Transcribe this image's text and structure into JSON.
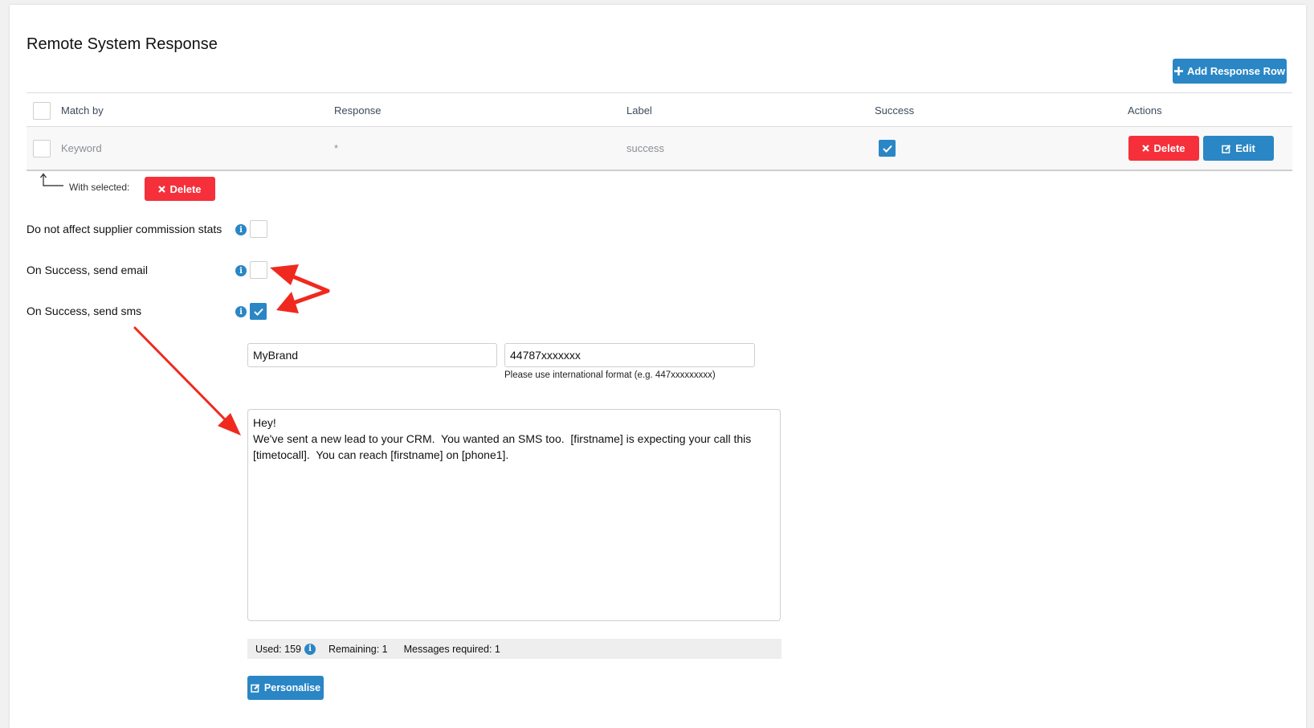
{
  "title": "Remote System Response",
  "add_button": "Add Response Row",
  "table": {
    "headers": [
      "Match by",
      "Response",
      "Label",
      "Success",
      "Actions"
    ],
    "rows": [
      {
        "match_by": "Keyword",
        "response": "*",
        "label": "success",
        "success": true
      }
    ],
    "delete_label": "Delete",
    "edit_label": "Edit"
  },
  "bulk": {
    "with_selected": "With selected:",
    "delete_label": "Delete"
  },
  "options": [
    {
      "label": "Do not affect supplier commission stats",
      "checked": false
    },
    {
      "label": "On Success, send email",
      "checked": false
    },
    {
      "label": "On Success, send sms",
      "checked": true
    }
  ],
  "sms": {
    "sender": "MyBrand",
    "number": "44787xxxxxxx",
    "number_help": "Please use international format (e.g. 447xxxxxxxxx)",
    "message": "Hey!\nWe've sent a new lead to your CRM.  You wanted an SMS too.  [firstname] is expecting your call this [timetocall].  You can reach [firstname] on [phone1].",
    "used_label": "Used: 159",
    "remaining_label": "Remaining: 1",
    "required_label": "Messages required: 1",
    "personalise_label": "Personalise"
  },
  "colors": {
    "primary": "#2a86c5",
    "danger": "#f5303b",
    "annotation": "#f0291f"
  }
}
